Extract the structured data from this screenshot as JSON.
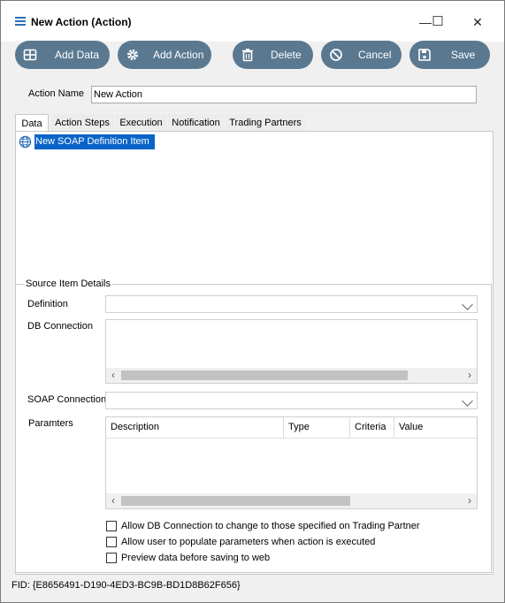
{
  "window": {
    "title": "New Action (Action)",
    "minimize": "—",
    "maximize": "☐",
    "close": "✕"
  },
  "toolbar": {
    "add_data": "Add Data",
    "add_action": "Add Action",
    "delete": "Delete",
    "cancel": "Cancel",
    "save": "Save"
  },
  "action_name": {
    "label": "Action Name",
    "value": "New Action"
  },
  "tabs": [
    "Data",
    "Action Steps",
    "Execution",
    "Notification",
    "Trading Partners"
  ],
  "tree": {
    "items": [
      "New SOAP Definition Item"
    ]
  },
  "source_details": {
    "title": "Source Item Details",
    "definition_label": "Definition",
    "db_connection_label": "DB Connection",
    "soap_connection_label": "SOAP Connection",
    "parameters_label": "Paramters",
    "grid_columns": [
      "Description",
      "Type",
      "Criteria",
      "Value"
    ]
  },
  "checkboxes": [
    {
      "label": "Allow DB Connection to change to those specified on Trading Partner",
      "checked": false
    },
    {
      "label": "Allow user to populate parameters when action is executed",
      "checked": false
    },
    {
      "label": "Preview data before saving to web",
      "checked": false
    }
  ],
  "fid": "FID: {E8656491-D190-4ED3-BC9B-BD1D8B62F656}",
  "colors": {
    "button_bg": "#5a7991",
    "selection": "#0a64c8",
    "icon_blue": "#2a6fb5"
  }
}
